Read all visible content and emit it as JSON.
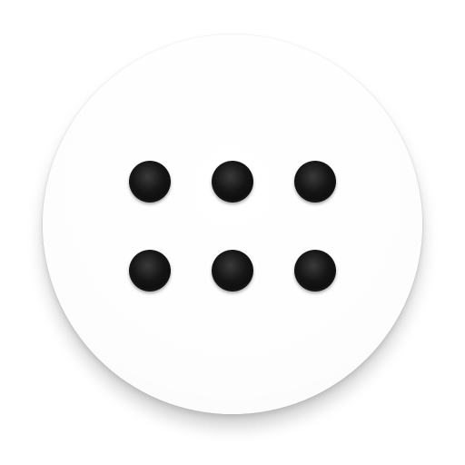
{
  "icon": {
    "name": "app-drawer-grid-icon",
    "background_color": "#ffffff",
    "dot_color": "#111111",
    "dots": [
      {
        "row": 1,
        "col": 1
      },
      {
        "row": 1,
        "col": 2
      },
      {
        "row": 1,
        "col": 3
      },
      {
        "row": 2,
        "col": 1
      },
      {
        "row": 2,
        "col": 2
      },
      {
        "row": 2,
        "col": 3
      }
    ]
  }
}
